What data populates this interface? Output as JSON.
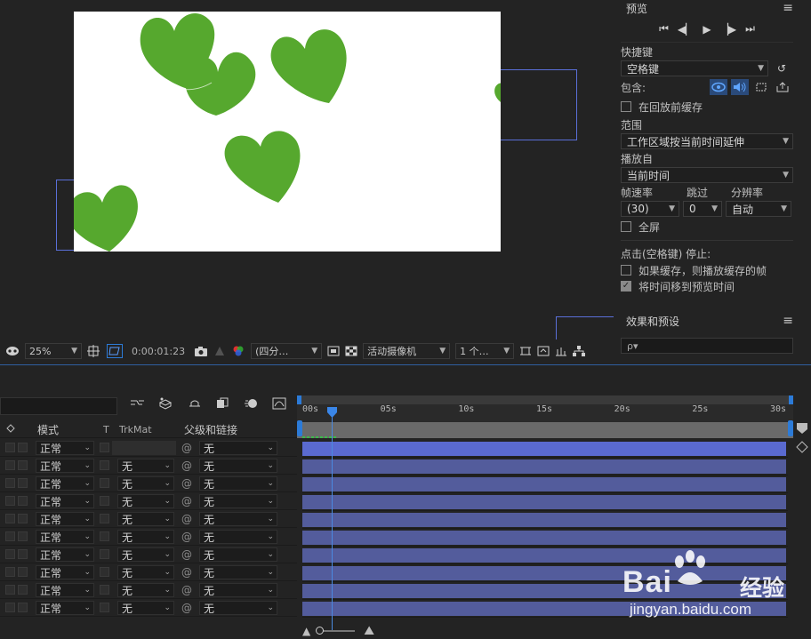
{
  "viewer_toolbar": {
    "zoom": "25%",
    "timecode": "0:00:01:23",
    "resolution": "(四分…",
    "camera": "活动摄像机",
    "views": "1 个…"
  },
  "preview": {
    "title": "预览",
    "shortcut_label": "快捷键",
    "shortcut_value": "空格键",
    "include_label": "包含:",
    "cache_before_playback": "在回放前缓存",
    "range_label": "范围",
    "range_value": "工作区域按当前时间延伸",
    "play_from_label": "播放自",
    "play_from_value": "当前时间",
    "frame_rate_label": "帧速率",
    "skip_label": "跳过",
    "resolution_label": "分辨率",
    "frame_rate_value": "(30)",
    "skip_value": "0",
    "resolution_value": "自动",
    "fullscreen_label": "全屏",
    "stop_hint": "点击(空格键) 停止:",
    "if_cached": "如果缓存，则播放缓存的帧",
    "move_time": "将时间移到预览时间"
  },
  "effects": {
    "title": "效果和预设",
    "search_placeholder": "ρ▾"
  },
  "timeline": {
    "col_mode": "模式",
    "col_t": "T",
    "col_trkmat": "TrkMat",
    "col_parent": "父级和链接",
    "rows": [
      {
        "mode": "正常",
        "trkmat": "",
        "parent": "无"
      },
      {
        "mode": "正常",
        "trkmat": "无",
        "parent": "无"
      },
      {
        "mode": "正常",
        "trkmat": "无",
        "parent": "无"
      },
      {
        "mode": "正常",
        "trkmat": "无",
        "parent": "无"
      },
      {
        "mode": "正常",
        "trkmat": "无",
        "parent": "无"
      },
      {
        "mode": "正常",
        "trkmat": "无",
        "parent": "无"
      },
      {
        "mode": "正常",
        "trkmat": "无",
        "parent": "无"
      },
      {
        "mode": "正常",
        "trkmat": "无",
        "parent": "无"
      },
      {
        "mode": "正常",
        "trkmat": "无",
        "parent": "无"
      },
      {
        "mode": "正常",
        "trkmat": "无",
        "parent": "无"
      }
    ],
    "ticks": [
      "00s",
      "05s",
      "10s",
      "15s",
      "20s",
      "25s",
      "30s"
    ]
  },
  "watermark": {
    "brand": "Bai",
    "brand2": "经验",
    "url": "jingyan.baidu.com"
  },
  "colors": {
    "heart_green": "#56a82e",
    "layer_bar": "#535c9c",
    "accent_blue": "#2c7bd8"
  }
}
